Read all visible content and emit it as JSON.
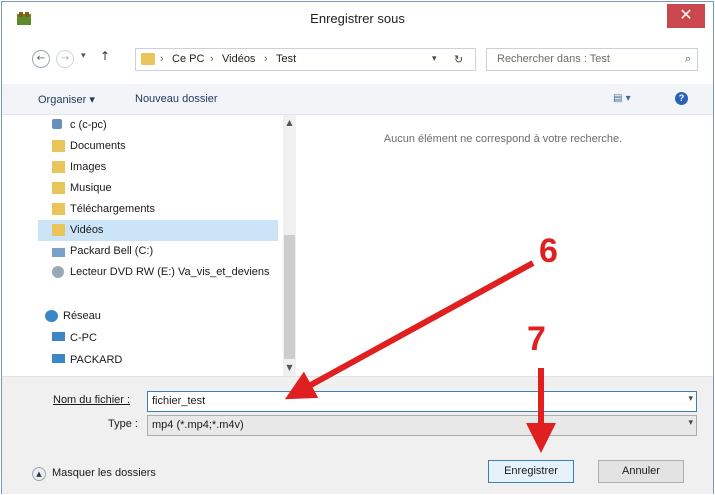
{
  "window": {
    "title": "Enregistrer sous",
    "close_glyph": "✕"
  },
  "nav": {
    "back_glyph": "←",
    "forward_glyph": "→",
    "dropdown_glyph": "▾",
    "up_glyph": "↑",
    "breadcrumb": [
      "Ce PC",
      "Vidéos",
      "Test"
    ],
    "separator": "›",
    "refresh_glyph": "↻",
    "search_placeholder": "Rechercher dans : Test",
    "search_glyph": "⌕"
  },
  "toolbar": {
    "organize_label": "Organiser ▾",
    "new_folder_label": "Nouveau dossier",
    "view_glyph": "▤ ▾",
    "help_glyph": "?"
  },
  "sidebar": {
    "items": [
      {
        "label": "c (c-pc)",
        "icon": "network-drive-icon",
        "color": "#6a8fbf"
      },
      {
        "label": "Documents",
        "icon": "documents-folder-icon",
        "color": "#e8c55a"
      },
      {
        "label": "Images",
        "icon": "images-folder-icon",
        "color": "#e8c55a"
      },
      {
        "label": "Musique",
        "icon": "music-folder-icon",
        "color": "#e8c55a"
      },
      {
        "label": "Téléchargements",
        "icon": "downloads-folder-icon",
        "color": "#e8c55a"
      },
      {
        "label": "Vidéos",
        "icon": "videos-folder-icon",
        "color": "#e8c55a"
      },
      {
        "label": "Packard Bell (C:)",
        "icon": "hard-drive-icon",
        "color": "#7aa0c8"
      },
      {
        "label": "Lecteur DVD RW (E:) Va_vis_et_deviens",
        "icon": "dvd-drive-icon",
        "color": "#9aa8b4"
      },
      {
        "label": "Réseau",
        "icon": "network-icon",
        "color": "#3c86c8"
      },
      {
        "label": "C-PC",
        "icon": "computer-icon",
        "color": "#3c86c8"
      },
      {
        "label": "PACKARD",
        "icon": "computer-icon",
        "color": "#3c86c8"
      }
    ],
    "selected_index": 5,
    "scroll_up_glyph": "▲",
    "scroll_down_glyph": "▼"
  },
  "main": {
    "empty_message": "Aucun élément ne correspond à votre recherche."
  },
  "form": {
    "filename_label": "Nom du fichier :",
    "filename_value": "fichier_test",
    "type_label": "Type :",
    "type_value": "mp4 (*.mp4;*.m4v)",
    "dropdown_glyph": "▾"
  },
  "footer": {
    "hide_folders_glyph": "▲",
    "hide_folders_label": "Masquer les dossiers",
    "save_label": "Enregistrer",
    "cancel_label": "Annuler"
  },
  "annotations": {
    "step6_label": "6",
    "step7_label": "7",
    "arrow_color": "#e02020"
  }
}
